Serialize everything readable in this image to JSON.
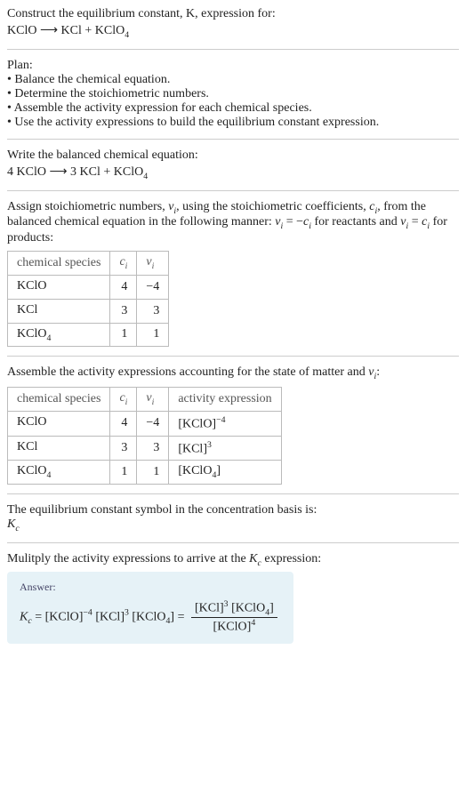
{
  "intro": {
    "line1": "Construct the equilibrium constant, K, expression for:",
    "eq_lhs": "KClO",
    "arrow": "⟶",
    "eq_rhs_a": "KCl + KClO",
    "eq_rhs_sub": "4"
  },
  "plan": {
    "heading": "Plan:",
    "b1": "• Balance the chemical equation.",
    "b2": "• Determine the stoichiometric numbers.",
    "b3": "• Assemble the activity expression for each chemical species.",
    "b4": "• Use the activity expressions to build the equilibrium constant expression."
  },
  "balanced": {
    "heading": "Write the balanced chemical equation:",
    "lhs": "4 KClO",
    "arrow": "⟶",
    "rhs_a": "3 KCl + KClO",
    "rhs_sub": "4"
  },
  "assign": {
    "text_a": "Assign stoichiometric numbers, ",
    "nu": "ν",
    "sub_i": "i",
    "text_b": ", using the stoichiometric coefficients, ",
    "c": "c",
    "text_c": ", from the balanced chemical equation in the following manner: ",
    "eq1_lhs": "ν",
    "eq1_eq": " = −",
    "eq1_rhs": "c",
    "text_d": " for reactants and ",
    "eq2_lhs": "ν",
    "eq2_eq": " = ",
    "eq2_rhs": "c",
    "text_e": " for products:"
  },
  "table1": {
    "h1": "chemical species",
    "h2": "c",
    "h2_sub": "i",
    "h3": "ν",
    "h3_sub": "i",
    "rows": [
      {
        "sp": "KClO",
        "sp_sub": "",
        "c": "4",
        "nu": "−4"
      },
      {
        "sp": "KCl",
        "sp_sub": "",
        "c": "3",
        "nu": "3"
      },
      {
        "sp": "KClO",
        "sp_sub": "4",
        "c": "1",
        "nu": "1"
      }
    ]
  },
  "assemble": {
    "text_a": "Assemble the activity expressions accounting for the state of matter and ",
    "nu": "ν",
    "sub_i": "i",
    "text_b": ":"
  },
  "table2": {
    "h1": "chemical species",
    "h2": "c",
    "h2_sub": "i",
    "h3": "ν",
    "h3_sub": "i",
    "h4": "activity expression",
    "rows": [
      {
        "sp": "KClO",
        "sp_sub": "",
        "c": "4",
        "nu": "−4",
        "ae_base": "[KClO]",
        "ae_sup": "−4",
        "ae_sub": ""
      },
      {
        "sp": "KCl",
        "sp_sub": "",
        "c": "3",
        "nu": "3",
        "ae_base": "[KCl]",
        "ae_sup": "3",
        "ae_sub": ""
      },
      {
        "sp": "KClO",
        "sp_sub": "4",
        "c": "1",
        "nu": "1",
        "ae_base": "[KClO",
        "ae_sup": "",
        "ae_sub": "4",
        "ae_tail": "]"
      }
    ]
  },
  "symbol": {
    "text": "The equilibrium constant symbol in the concentration basis is:",
    "K": "K",
    "sub": "c"
  },
  "multiply": {
    "text_a": "Mulitply the activity expressions to arrive at the ",
    "K": "K",
    "sub": "c",
    "text_b": " expression:"
  },
  "answer": {
    "label": "Answer:",
    "K": "K",
    "Ksub": "c",
    "t1": " = [KClO]",
    "t1_sup": "−4",
    "t2": " [KCl]",
    "t2_sup": "3",
    "t3": " [KClO",
    "t3_sub": "4",
    "t3_tail": "] = ",
    "frac_num_a": "[KCl]",
    "frac_num_a_sup": "3",
    "frac_num_b": " [KClO",
    "frac_num_b_sub": "4",
    "frac_num_tail": "]",
    "frac_den_a": "[KClO]",
    "frac_den_a_sup": "4"
  }
}
